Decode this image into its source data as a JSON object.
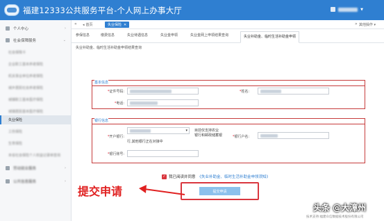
{
  "header": {
    "title": "福建12333公共服务平台-个人网上办事大厅",
    "user_caret": "▼"
  },
  "crumbs": {
    "home": "首页",
    "active": "失业保险",
    "close": "✕",
    "more": "其他操作 ▾"
  },
  "sidebar": {
    "groups": [
      {
        "label": "个人中心"
      },
      {
        "label": "社会保障服务"
      },
      {
        "label": "劳动就业服务"
      },
      {
        "label": "公共信息服务"
      }
    ],
    "items": [
      {
        "label": "社会保障卡",
        "active": false
      },
      {
        "label": "企业职工基本养老保险",
        "active": false
      },
      {
        "label": "机关事业单位养老保险",
        "active": false
      },
      {
        "label": "城乡居民社会养老保险",
        "active": false
      },
      {
        "label": "城镇职工基本医疗保险",
        "active": false
      },
      {
        "label": "城镇居民基本医疗保险",
        "active": false
      },
      {
        "label": "失业保险",
        "active": true
      },
      {
        "label": "工伤保险",
        "active": false
      },
      {
        "label": "生育保险",
        "active": false
      },
      {
        "label": "本省社会保险个人权益记录单查询",
        "active": false
      }
    ]
  },
  "tabs": [
    {
      "label": "参保信息",
      "active": false
    },
    {
      "label": "缴费信息",
      "active": false
    },
    {
      "label": "失业待遇信息",
      "active": false
    },
    {
      "label": "失业金申领",
      "active": false
    },
    {
      "label": "失业金网上申领结果查询",
      "active": false
    },
    {
      "label": "失业补助金、临时生活补助金申领",
      "active": true
    }
  ],
  "subtab": "失业补助金、临时生活补助金申领结果查询",
  "basic_info": {
    "title": "基本信息",
    "id_label": "证件号码:",
    "name_label": "姓名:",
    "phone_label": "电话:",
    "required_mark": "*"
  },
  "bank_info": {
    "title": "银行信息",
    "bank_label": "开户银行:",
    "account_name_label": "银行户名:",
    "account_no_label": "银行账号:",
    "hint_line1": "目前仅支持农业",
    "hint_line2": "银行和邮政储蓄银",
    "hint_line3": "行,其他银行正在对接中",
    "select_caret": "▾"
  },
  "agreement": {
    "check": "✓",
    "text": "我已阅读并同意",
    "link": "《失业补助金、临时生活补助金申领须知》"
  },
  "submit_label": "提交申请",
  "annotation": "提交申请",
  "watermark": "头条 @大漳州",
  "footer": "技术支持:福建众信数据技术股份有限公司"
}
